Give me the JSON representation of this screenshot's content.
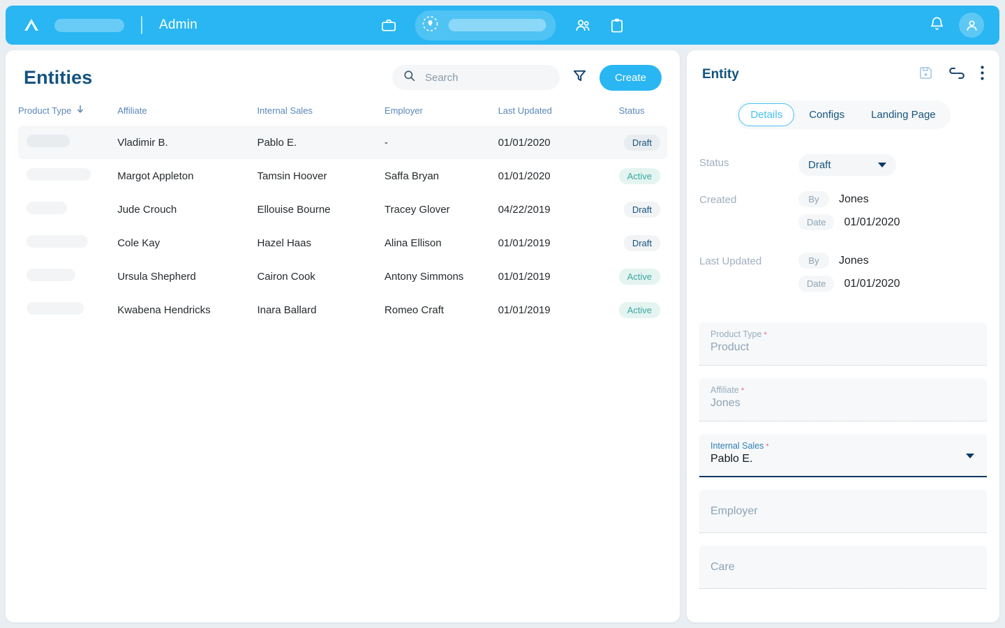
{
  "topbar": {
    "logo_icon": "cloud-logo-icon",
    "brand_placeholder": "",
    "title": "Admin",
    "briefcase_icon": "briefcase-icon",
    "location_icon": "location-pin-icon",
    "search_placeholder": "",
    "people_icon": "people-icon",
    "clipboard_icon": "clipboard-icon",
    "bell_icon": "bell-icon",
    "avatar_icon": "user-avatar-icon"
  },
  "list": {
    "title": "Entities",
    "search": {
      "placeholder": "Search",
      "value": "",
      "icon": "search-icon"
    },
    "filter_icon": "filter-funnel-icon",
    "create_label": "Create",
    "columns": [
      {
        "label": "Product Type",
        "sorted": true,
        "sort_icon": "arrow-down-icon"
      },
      {
        "label": "Affiliate",
        "sorted": false
      },
      {
        "label": "Internal Sales",
        "sorted": false
      },
      {
        "label": "Employer",
        "sorted": false
      },
      {
        "label": "Last Updated",
        "sorted": false
      },
      {
        "label": "Status",
        "sorted": false
      }
    ],
    "rows": [
      {
        "product_type_width": 62,
        "affiliate": "Vladimir B.",
        "internal_sales": "Pablo E.",
        "employer": "-",
        "last_updated": "01/01/2020",
        "status": "Draft",
        "selected": true
      },
      {
        "product_type_width": 92,
        "affiliate": "Margot Appleton",
        "internal_sales": "Tamsin Hoover",
        "employer": "Saffa Bryan",
        "last_updated": "01/01/2020",
        "status": "Active",
        "selected": false
      },
      {
        "product_type_width": 58,
        "affiliate": "Jude Crouch",
        "internal_sales": "Ellouise Bourne",
        "employer": "Tracey Glover",
        "last_updated": "04/22/2019",
        "status": "Draft",
        "selected": false
      },
      {
        "product_type_width": 88,
        "affiliate": "Cole Kay",
        "internal_sales": "Hazel Haas",
        "employer": "Alina Ellison",
        "last_updated": "01/01/2019",
        "status": "Draft",
        "selected": false
      },
      {
        "product_type_width": 70,
        "affiliate": "Ursula Shepherd",
        "internal_sales": "Cairon Cook",
        "employer": "Antony Simmons",
        "last_updated": "01/01/2019",
        "status": "Active",
        "selected": false
      },
      {
        "product_type_width": 82,
        "affiliate": "Kwabena Hendricks",
        "internal_sales": "Inara Ballard",
        "employer": "Romeo Craft",
        "last_updated": "01/01/2019",
        "status": "Active",
        "selected": false
      }
    ]
  },
  "detail": {
    "title": "Entity",
    "save_icon": "save-floppy-icon",
    "link_icon": "link-icon",
    "more_icon": "more-vertical-icon",
    "tabs": [
      {
        "label": "Details",
        "active": true
      },
      {
        "label": "Configs",
        "active": false
      },
      {
        "label": "Landing Page",
        "active": false
      }
    ],
    "status": {
      "label": "Status",
      "value": "Draft"
    },
    "created": {
      "label": "Created",
      "by_chip": "By",
      "by_value": "Jones",
      "date_chip": "Date",
      "date_value": "01/01/2020"
    },
    "last_updated": {
      "label": "Last Updated",
      "by_chip": "By",
      "by_value": "Jones",
      "date_chip": "Date",
      "date_value": "01/01/2020"
    },
    "fields": [
      {
        "label": "Product Type",
        "required": true,
        "value": "Product",
        "state": "disabled",
        "dropdown": false
      },
      {
        "label": "Affiliate",
        "required": true,
        "value": "Jones",
        "state": "disabled",
        "dropdown": false
      },
      {
        "label": "Internal Sales",
        "required": true,
        "value": "Pablo E.",
        "state": "active",
        "dropdown": true
      },
      {
        "label": "Employer",
        "required": false,
        "value": "",
        "state": "empty",
        "dropdown": false
      },
      {
        "label": "Care",
        "required": false,
        "value": "",
        "state": "empty",
        "dropdown": false
      }
    ]
  },
  "colors": {
    "brand_blue": "#29b6f2",
    "title_navy": "#13537f",
    "active_teal": "#3aa89f",
    "active_bg": "#e4f4f1",
    "draft_navy": "#17547e",
    "required_red": "#e8607d",
    "tab_active_border": "#46c1f0"
  }
}
